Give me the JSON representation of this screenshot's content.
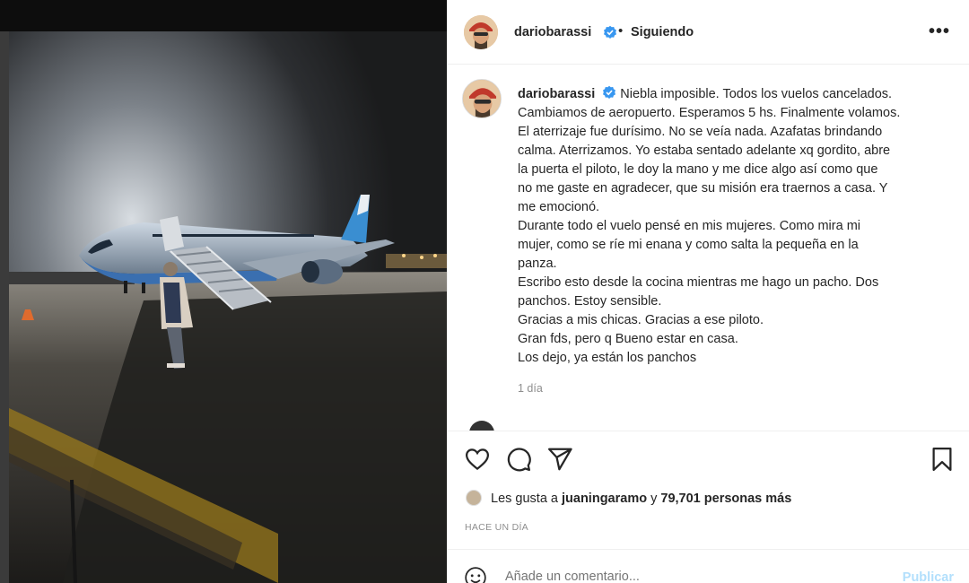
{
  "post": {
    "username": "dariobarassi",
    "follow_status": "Siguiendo",
    "separator": "•",
    "more_label": "•••",
    "caption_lines": [
      "Niebla imposible. Todos los vuelos cancelados.",
      "Cambiamos de aeropuerto. Esperamos 5 hs. Finalmente volamos.",
      "El aterrizaje fue durísimo. No se veía nada. Azafatas brindando",
      "calma. Aterrizamos. Yo estaba sentado adelante xq gordito, abre",
      "la puerta el piloto, le doy la mano y me dice algo así como que",
      "no me gaste en agradecer, que su misión era traernos a casa. Y",
      "me emocionó.",
      "Durante todo el vuelo pensé en mis mujeres. Como mira mi",
      "mujer, como se ríe mi enana y como salta la pequeña en la",
      "panza.",
      "Escribo esto desde la cocina mientras me hago un pacho. Dos",
      "panchos. Estoy sensible.",
      "Gracias a mis chicas. Gracias a ese piloto.",
      "Gran fds, pero q Bueno estar en casa.",
      "Los dejo, ya están los panchos"
    ],
    "time_ago": "1 día",
    "likes_prefix": "Les gusta a ",
    "likes_user": "juaningaramo",
    "likes_mid": " y ",
    "likes_count": "79,701 personas más",
    "posted": "HACE UN DÍA",
    "comment_placeholder": "Añade un comentario...",
    "publish_label": "Publicar"
  },
  "colors": {
    "verified": "#3897f0",
    "publish": "#b2dffc",
    "muted": "#8e8e8e",
    "text": "#262626"
  },
  "icons": [
    "verified-badge-icon",
    "more-options-icon",
    "heart-icon",
    "comment-icon",
    "share-icon",
    "bookmark-icon",
    "emoji-icon"
  ]
}
